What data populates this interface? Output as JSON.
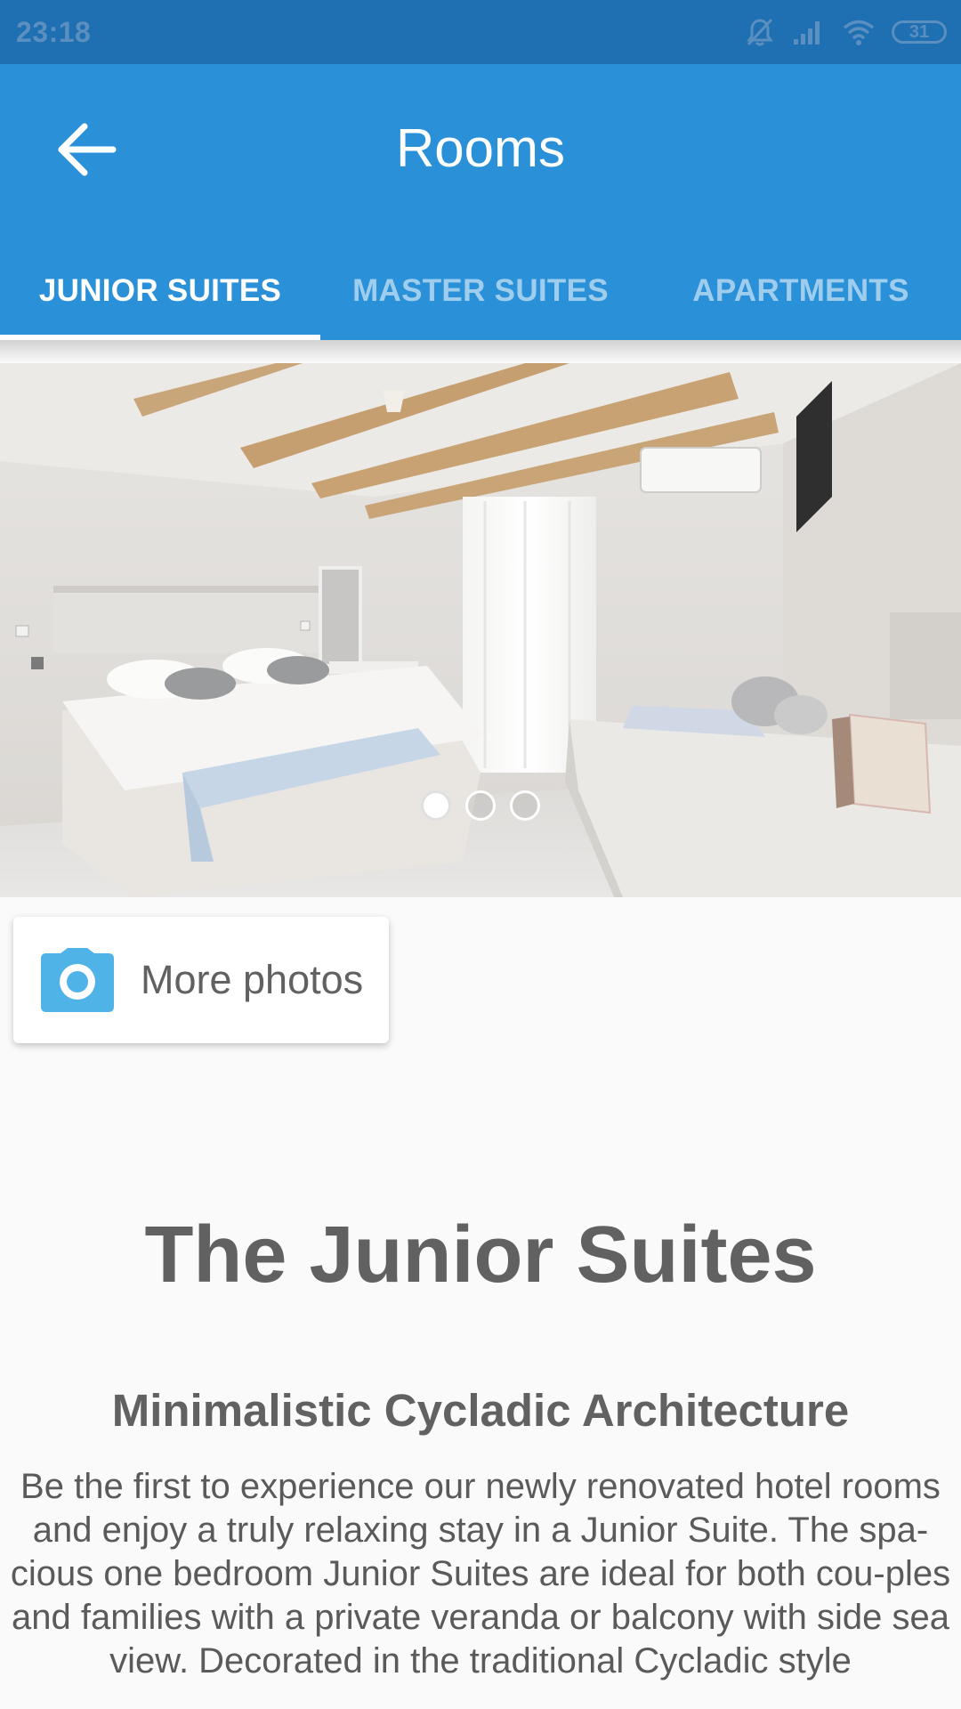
{
  "status_bar": {
    "time": "23:18",
    "battery": "31",
    "icons": [
      "notifications-off-icon",
      "signal-icon",
      "wifi-icon",
      "battery-icon"
    ]
  },
  "app_bar": {
    "title": "Rooms",
    "back_icon": "arrow-left-icon",
    "background_color": "#2a90d8"
  },
  "tabs": [
    {
      "label": "JUNIOR SUITES",
      "active": true
    },
    {
      "label": "MASTER SUITES",
      "active": false
    },
    {
      "label": "APARTMENTS",
      "active": false
    }
  ],
  "carousel": {
    "page_count": 3,
    "current_page": 1
  },
  "more_photos": {
    "label": "More photos",
    "icon": "camera-icon",
    "icon_color": "#4fb3e8"
  },
  "content": {
    "title": "The Junior Suites",
    "subtitle": "Minimalistic Cycladic Architecture",
    "body": "Be the first to experience our newly renovated hotel rooms and enjoy a truly relaxing stay in a Junior Suite. The spa-cious one bedroom Junior Suites are ideal for both cou-ples and families with a private veranda or balcony with side sea view. Decorated in the traditional Cycladic style"
  }
}
